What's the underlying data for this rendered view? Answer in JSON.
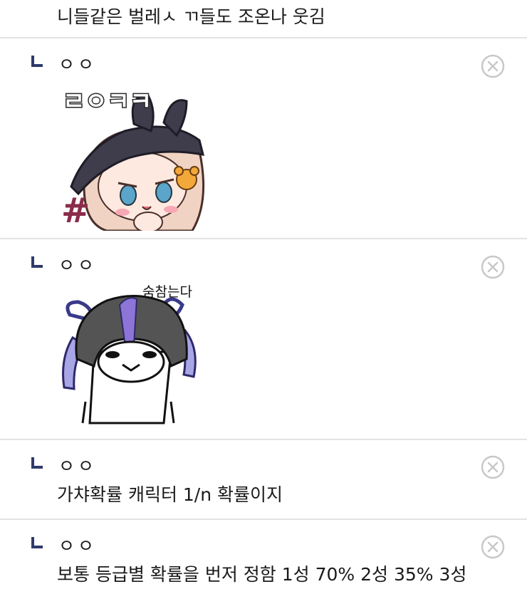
{
  "top_comment": {
    "text": "니들같은 벌레ㅅ ㄲ들도 조온나 웃김"
  },
  "replies": [
    {
      "nickname": "ㅇㅇ",
      "type": "sticker",
      "sticker_text": "ㄹㅇㅋㅋ"
    },
    {
      "nickname": "ㅇㅇ",
      "type": "sticker",
      "sticker_text": "숨참는다"
    },
    {
      "nickname": "ㅇㅇ",
      "type": "text",
      "text": "가챠확률 캐릭터 1/n 확률이지"
    },
    {
      "nickname": "ㅇㅇ",
      "type": "text",
      "text": "보통 등급별 확률을 번저 정함 1성 70% 2성 35% 3성"
    }
  ],
  "icons": {
    "reply": "reply-arrow-icon",
    "delete": "close-circle-icon"
  },
  "colors": {
    "divider": "#e3e3e3",
    "reply_icon": "#2f3a6b",
    "close_icon": "#c8c8c8"
  }
}
